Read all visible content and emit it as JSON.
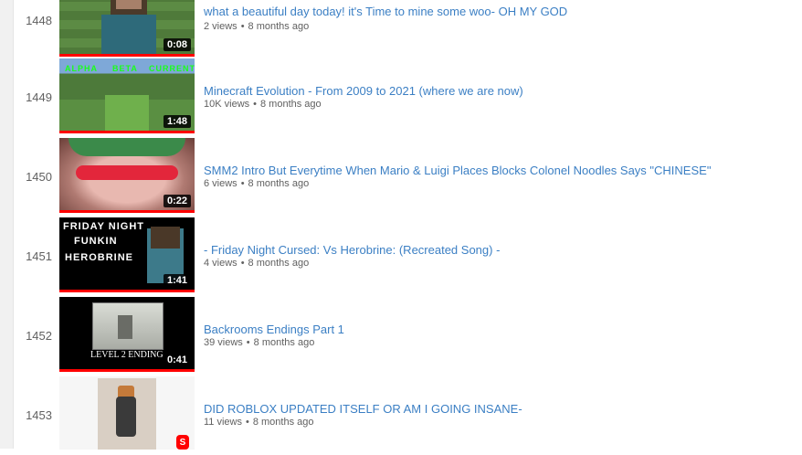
{
  "playlist": {
    "items": [
      {
        "index": "1448",
        "title": "what a beautiful day today! it's Time to mine some woo- OH MY GOD",
        "views": "2 views",
        "age": "8 months ago",
        "duration": "0:08"
      },
      {
        "index": "1449",
        "title": "Minecraft Evolution - From 2009 to 2021 (where we are now)",
        "views": "10K views",
        "age": "8 months ago",
        "duration": "1:48",
        "thumb_labels": [
          "ALPHA",
          "BETA",
          "CURRENT"
        ]
      },
      {
        "index": "1450",
        "title": "SMM2 Intro But Everytime When Mario & Luigi Places Blocks Colonel Noodles Says \"CHINESE\"",
        "views": "6 views",
        "age": "8 months ago",
        "duration": "0:22"
      },
      {
        "index": "1451",
        "title": "- Friday Night Cursed: Vs Herobrine: (Recreated Song) -",
        "views": "4 views",
        "age": "8 months ago",
        "duration": "1:41",
        "thumb_labels": [
          "FRIDAY NIGHT",
          "FUNKIN",
          "HEROBRINE"
        ]
      },
      {
        "index": "1452",
        "title": "Backrooms Endings Part 1",
        "views": "39 views",
        "age": "8 months ago",
        "duration": "0:41",
        "thumb_labels": [
          "LEVEL 2 ENDING"
        ]
      },
      {
        "index": "1453",
        "title": "DID ROBLOX UPDATED ITSELF OR AM I GOING INSANE-",
        "views": "11 views",
        "age": "8 months ago",
        "shorts_badge": "shorts-icon"
      }
    ],
    "separator": "•"
  },
  "colors": {
    "title": "#3b7fc4",
    "meta": "#606060",
    "progress": "#ff0000"
  }
}
